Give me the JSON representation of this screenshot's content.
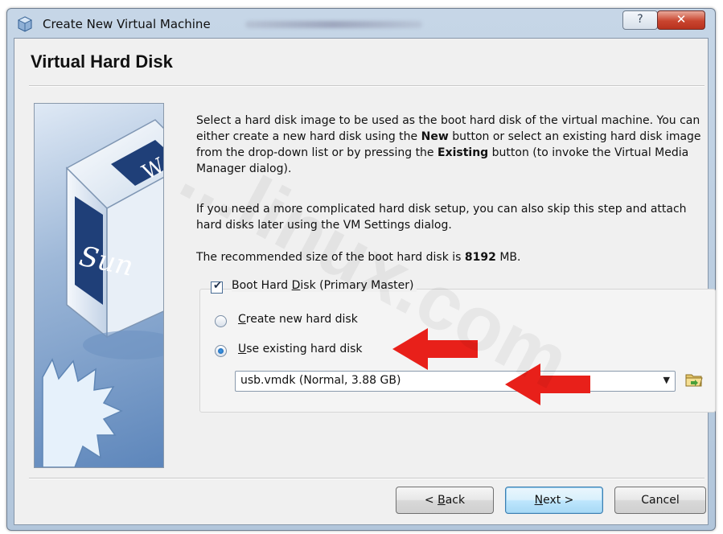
{
  "window": {
    "title": "Create New Virtual Machine",
    "help_label": "?",
    "close_label": "✕"
  },
  "page": {
    "title": "Virtual Hard Disk",
    "para1": {
      "t1": "Select a hard disk image to be used as the boot hard disk of the virtual machine. You can either create a new hard disk using the ",
      "b1": "New",
      "t2": " button or select an existing hard disk image from the drop-down list or by pressing the ",
      "b2": "Existing",
      "t3": " button (to invoke the Virtual Media Manager dialog)."
    },
    "para2": "If you need a more complicated hard disk setup, you can also skip this step and attach hard disks later using the VM Settings dialog.",
    "para3": {
      "t1": "The recommended size of the boot hard disk is ",
      "size": "8192",
      "t2": " MB."
    }
  },
  "options": {
    "boot_disk_checkbox": {
      "label_pre": "Boot Hard ",
      "label_mn": "D",
      "label_post": "isk (Primary Master)",
      "checked": true
    },
    "create_new": {
      "label_mn": "C",
      "label_post": "reate new hard disk",
      "selected": false
    },
    "use_existing": {
      "label_mn": "U",
      "label_post": "se existing hard disk",
      "selected": true
    },
    "disk_select": {
      "value": "usb.vmdk (Normal, 3.88 GB)"
    }
  },
  "buttons": {
    "back": {
      "pre": "< ",
      "mn": "B",
      "post": "ack"
    },
    "next": {
      "mn": "N",
      "post": "ext >"
    },
    "cancel": "Cancel"
  },
  "colors": {
    "annotation_arrow": "#e8201a"
  },
  "watermark": "...linux.com",
  "icons": [
    "virtualbox-icon",
    "folder-open-icon",
    "chevron-down-icon"
  ]
}
